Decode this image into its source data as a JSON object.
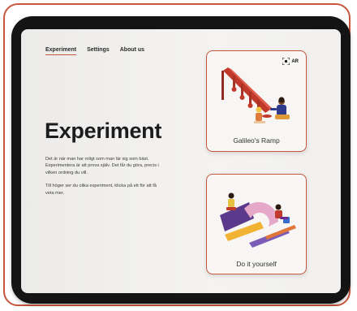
{
  "nav": {
    "tabs": [
      {
        "label": "Experiment",
        "active": true
      },
      {
        "label": "Settings",
        "active": false
      },
      {
        "label": "About us",
        "active": false
      }
    ]
  },
  "main": {
    "title": "Experiment",
    "paragraph1": "Det är när man har roligt som man lär sig som bäst. Experimentera är att prova själv. Det får du göra, precis i vilken ordning du vill.",
    "paragraph2": "Till höger ser du olika experiment, klicka på ett för att få veta mer."
  },
  "cards": [
    {
      "label": "Galileo's Ramp",
      "badge": "AR",
      "badge_icon": "ar-scan-icon"
    },
    {
      "label": "Do it yourself"
    }
  ],
  "colors": {
    "accent": "#c8553d",
    "ramp_red": "#c0392b",
    "background": "#f1f0ee",
    "device": "#141414"
  }
}
